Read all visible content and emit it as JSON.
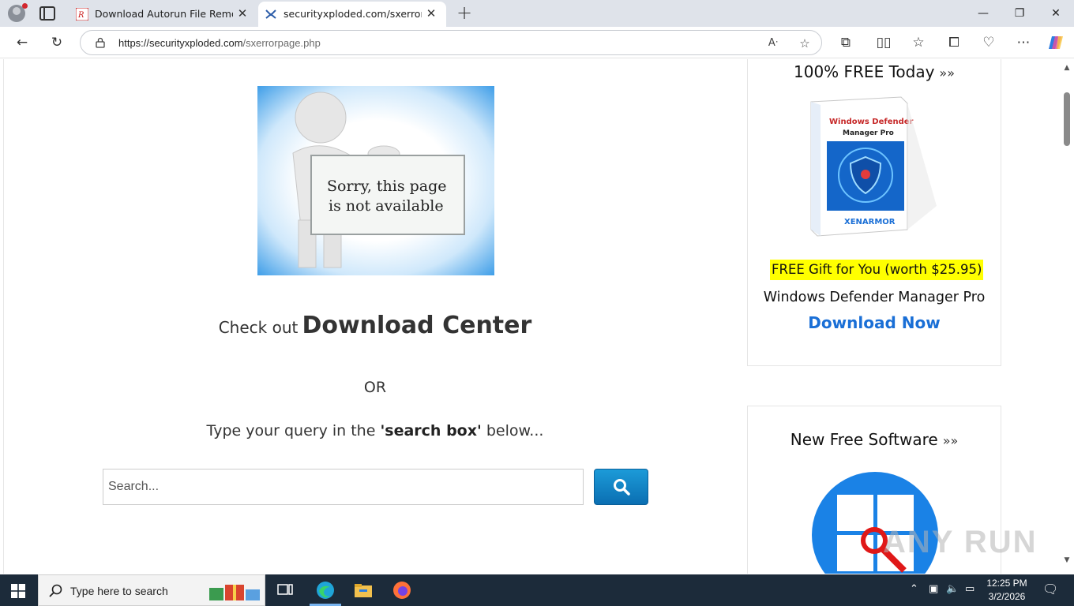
{
  "browser": {
    "tabs": [
      {
        "title": "Download Autorun File Remover"
      },
      {
        "title": "securityxploded.com/sxerrorpage"
      }
    ],
    "url_host": "https://securityxploded.com",
    "url_path": "/sxerrorpage.php"
  },
  "page": {
    "error_image_text_line1": "Sorry, this page",
    "error_image_text_line2": "is not available",
    "check_out_prefix": "Check out",
    "download_center": "Download Center",
    "or": "OR",
    "type_query_prefix": "Type your query in the",
    "type_query_bold": "'search box'",
    "type_query_suffix": "below...",
    "search_placeholder": "Search..."
  },
  "sidebar": {
    "free_today_title": "100% FREE Today",
    "arrows": "»»",
    "box_title": "Windows Defender",
    "box_subtitle": "Manager Pro",
    "box_brand": "XENARMOR",
    "gift_text": "FREE Gift for You (worth $25.95)",
    "product_name": "Windows Defender Manager Pro",
    "download_now": "Download Now",
    "new_free_title": "New Free Software"
  },
  "taskbar": {
    "search_placeholder": "Type here to search",
    "time": "12:25 PM",
    "date": "3/2/2026"
  },
  "watermark": "ANY RUN",
  "colors": {
    "link_blue": "#1a6fd6",
    "highlight_yellow": "#ffff00",
    "search_button": "#0b6fb2",
    "taskbar": "#1c2b3a"
  }
}
